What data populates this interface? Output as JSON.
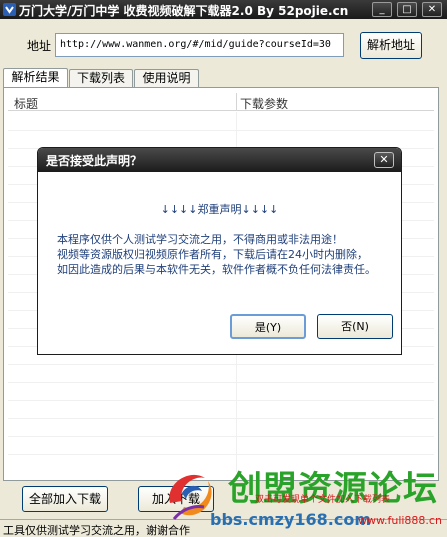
{
  "window": {
    "title": "万门大学/万门中学 收费视频破解下载器2.0 By 52pojie.cn",
    "min": "_",
    "max": "□",
    "close": "✕"
  },
  "address": {
    "label": "地址",
    "value": "http://www.wanmen.org/#/mid/guide?courseId=30",
    "parse_button": "解析地址"
  },
  "tabs": [
    {
      "label": "解析结果",
      "active": true
    },
    {
      "label": "下载列表",
      "active": false
    },
    {
      "label": "使用说明",
      "active": false
    }
  ],
  "list": {
    "columns": [
      "标题",
      "下载参数"
    ]
  },
  "buttons": {
    "add_all": "全部加入下载",
    "second": "加入下载"
  },
  "status": {
    "text": "工具仅供测试学习交流之用，谢谢合作"
  },
  "dialog": {
    "title": "是否接受此声明？",
    "close": "✕",
    "heading": "↓↓↓↓郑重声明↓↓↓↓",
    "lines": [
      "本程序仅供个人测试学习交流之用，不得商用或非法用途！",
      "视频等资源版权归视频原作者所有，下载后请在24小时内删除，",
      "如因此造成的后果与本软件无关，软件作者概不负任何法律责任。"
    ],
    "yes": "是(Y)",
    "no": "否(N)"
  },
  "watermark": {
    "main": "创盟资源论坛",
    "sub": "双击可发现单个文件加入下载列表",
    "url1": "bbs.cmzy168.com",
    "url2": "www.fuli888.cn"
  }
}
